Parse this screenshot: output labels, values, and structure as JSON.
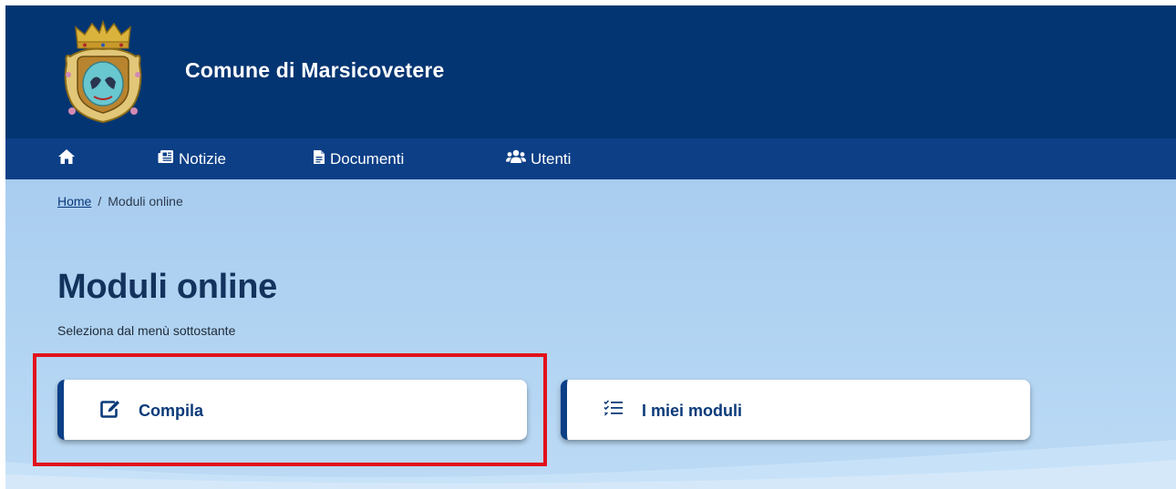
{
  "header": {
    "site_title": "Comune di Marsicovetere",
    "logo_icon": "municipal-coat-of-arms-icon",
    "background": "#033572"
  },
  "nav": {
    "background": "#0c3f86",
    "items": [
      {
        "label": "",
        "icon": "home-icon"
      },
      {
        "label": "Notizie",
        "icon": "newspaper-icon"
      },
      {
        "label": "Documenti",
        "icon": "file-icon"
      },
      {
        "label": "Utenti",
        "icon": "users-icon"
      }
    ]
  },
  "breadcrumb": {
    "home_label": "Home",
    "separator": "/",
    "current_label": "Moduli online"
  },
  "page": {
    "title": "Moduli online",
    "subtitle": "Seleziona dal menù sottostante"
  },
  "cards": [
    {
      "label": "Compila",
      "icon": "edit-icon"
    },
    {
      "label": "I miei moduli",
      "icon": "checklist-icon"
    }
  ],
  "highlight_color": "#e2111b"
}
